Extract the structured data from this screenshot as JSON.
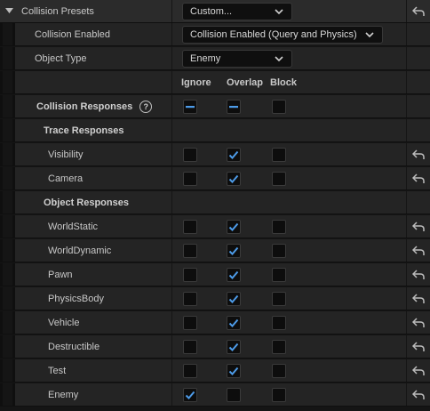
{
  "presets": {
    "label": "Collision Presets",
    "value": "Custom..."
  },
  "collision_enabled": {
    "label": "Collision Enabled",
    "value": "Collision Enabled (Query and Physics)"
  },
  "object_type": {
    "label": "Object Type",
    "value": "Enemy"
  },
  "columns": {
    "ignore": "Ignore",
    "overlap": "Overlap",
    "block": "Block"
  },
  "collision_responses": {
    "label": "Collision Responses",
    "help_glyph": "?"
  },
  "trace_responses": {
    "label": "Trace Responses",
    "items": [
      {
        "name": "Visibility",
        "ignore": false,
        "overlap": true,
        "block": false
      },
      {
        "name": "Camera",
        "ignore": false,
        "overlap": true,
        "block": false
      }
    ]
  },
  "object_responses": {
    "label": "Object Responses",
    "items": [
      {
        "name": "WorldStatic",
        "ignore": false,
        "overlap": true,
        "block": false
      },
      {
        "name": "WorldDynamic",
        "ignore": false,
        "overlap": true,
        "block": false
      },
      {
        "name": "Pawn",
        "ignore": false,
        "overlap": true,
        "block": false
      },
      {
        "name": "PhysicsBody",
        "ignore": false,
        "overlap": true,
        "block": false
      },
      {
        "name": "Vehicle",
        "ignore": false,
        "overlap": true,
        "block": false
      },
      {
        "name": "Destructible",
        "ignore": false,
        "overlap": true,
        "block": false
      },
      {
        "name": "Test",
        "ignore": false,
        "overlap": true,
        "block": false
      },
      {
        "name": "Enemy",
        "ignore": true,
        "overlap": false,
        "block": false
      }
    ]
  },
  "colors": {
    "accent": "#4d9be8",
    "panel": "#242424",
    "background": "#151515"
  },
  "icons": {
    "reset": "reset-arrow-icon",
    "expand": "triangle-down-icon",
    "dropdown": "chevron-down-icon",
    "help": "help-icon"
  }
}
